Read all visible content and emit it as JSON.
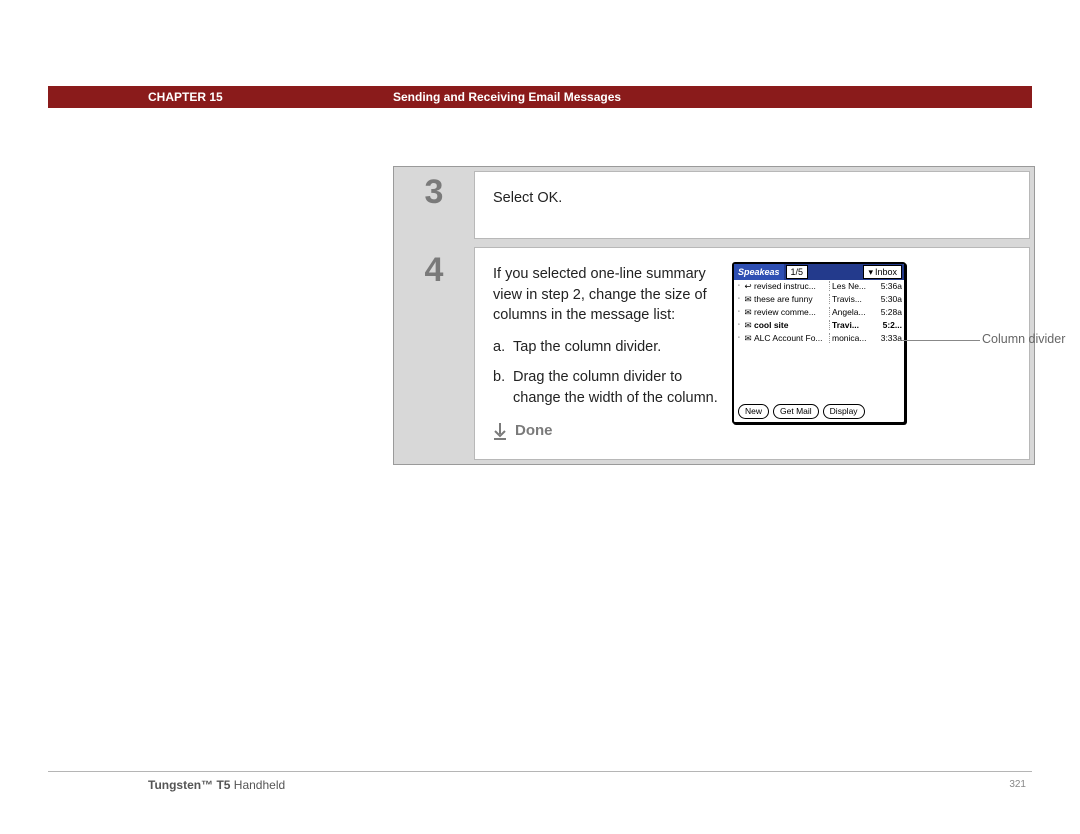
{
  "header": {
    "chapter_label": "CHAPTER 15",
    "chapter_title": "Sending and Receiving Email Messages"
  },
  "steps": {
    "s3": {
      "num": "3",
      "text": "Select OK."
    },
    "s4": {
      "num": "4",
      "intro": "If you selected one-line summary view in step 2, change the size of columns in the message list:",
      "a_letter": "a.",
      "a_text": "Tap the column divider.",
      "b_letter": "b.",
      "b_text": "Drag the column divider to change the width of the column.",
      "done": "Done"
    }
  },
  "palm": {
    "app": "Speakeas",
    "count": "1/5",
    "folder_label": "Inbox",
    "rows": [
      {
        "icon": "↩",
        "subject": "revised instruc...",
        "sender": "Les Ne...",
        "time": "5:36a",
        "bold": false
      },
      {
        "icon": "✉",
        "subject": "these are funny",
        "sender": "Travis...",
        "time": "5:30a",
        "bold": false
      },
      {
        "icon": "✉",
        "subject": "review comme...",
        "sender": "Angela...",
        "time": "5:28a",
        "bold": false
      },
      {
        "icon": "✉",
        "subject": "cool site",
        "sender": "Travi...",
        "time": "5:2...",
        "bold": true
      },
      {
        "icon": "✉",
        "subject": "ALC Account Fo...",
        "sender": "monica...",
        "time": "3:33a",
        "bold": false
      }
    ],
    "buttons": {
      "new": "New",
      "get": "Get Mail",
      "disp": "Display"
    }
  },
  "callout": {
    "label": "Column divider"
  },
  "footer": {
    "product_bold": "Tungsten™ T5",
    "product_rest": " Handheld",
    "page": "321"
  }
}
